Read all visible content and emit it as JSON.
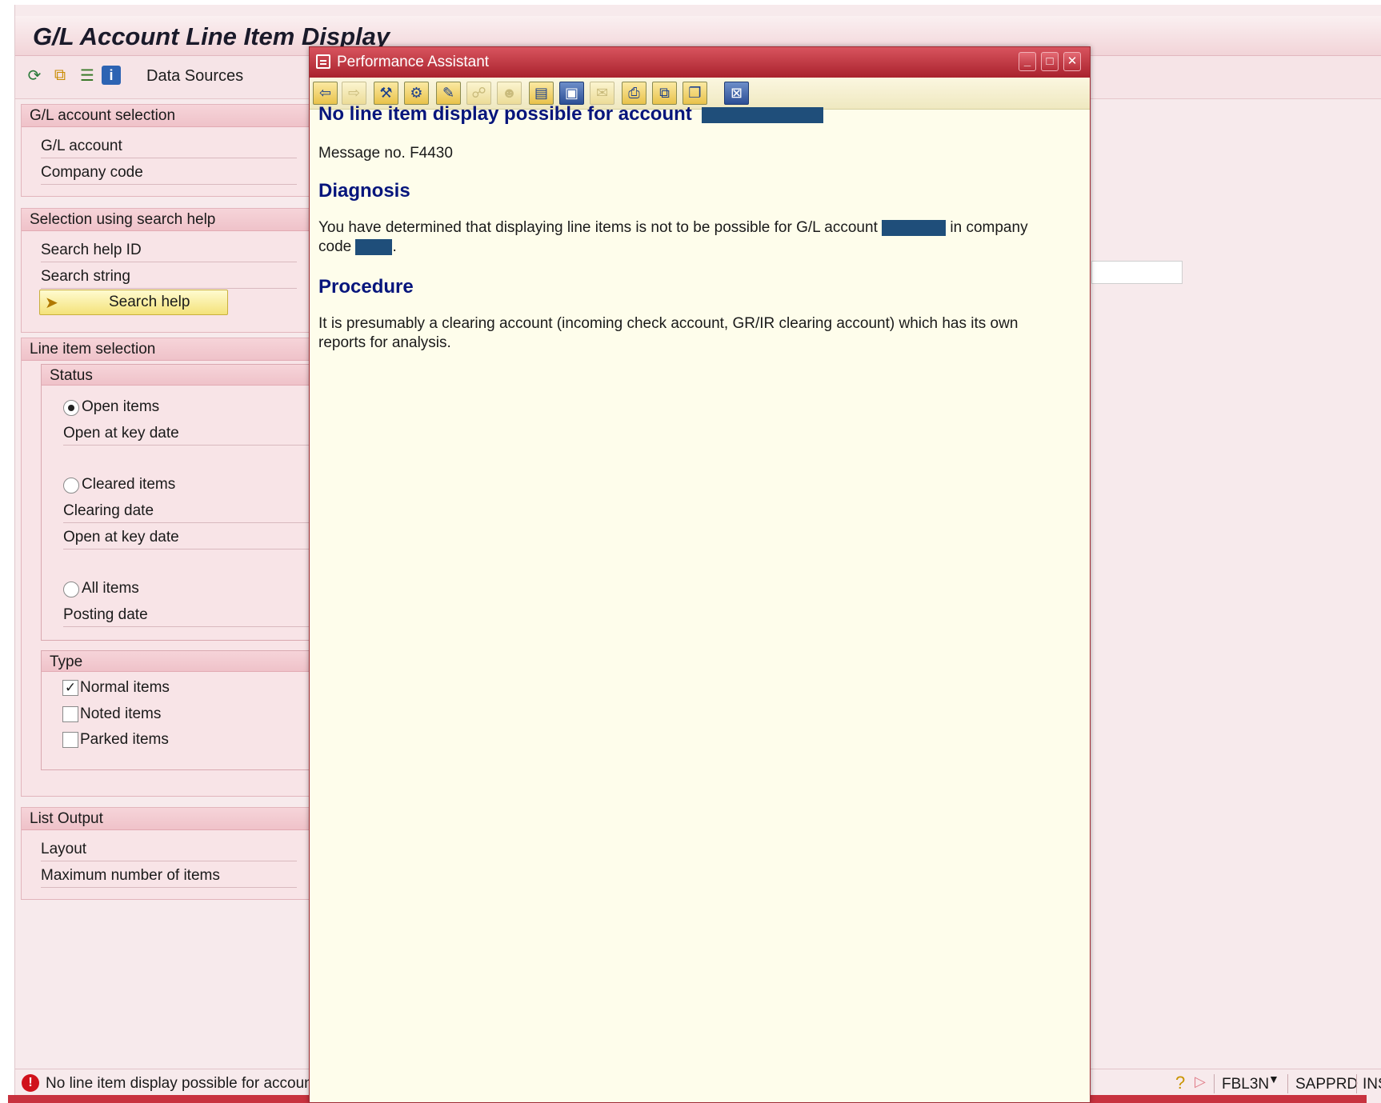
{
  "main": {
    "title": "G/L Account Line Item Display",
    "toolbar": {
      "data_sources_label": "Data Sources",
      "icons": [
        "execute-icon",
        "copy-icon",
        "multicolor-list-icon",
        "info-icon"
      ]
    },
    "groups": {
      "gl_account_selection": {
        "header": "G/L account selection",
        "fields": [
          "G/L account",
          "Company code"
        ]
      },
      "search_help_selection": {
        "header": "Selection using search help",
        "fields": [
          "Search help ID",
          "Search string"
        ],
        "button_label": "Search help"
      },
      "line_item_selection": {
        "header": "Line item selection",
        "status": {
          "header": "Status",
          "open_items": "Open items",
          "open_at_key_date": "Open at key date",
          "cleared_items": "Cleared items",
          "clearing_date": "Clearing date",
          "cleared_open_at_key_date": "Open at key date",
          "all_items": "All items",
          "posting_date": "Posting date",
          "selected": "open_items"
        },
        "type": {
          "header": "Type",
          "normal_items": "Normal items",
          "noted_items": "Noted items",
          "parked_items": "Parked items",
          "normal_checked": true,
          "noted_checked": false,
          "parked_checked": false
        }
      },
      "list_output": {
        "header": "List Output",
        "fields": [
          "Layout",
          "Maximum number of items"
        ]
      }
    }
  },
  "status_bar": {
    "message": "No line item display possible for account",
    "transaction": "FBL3N",
    "system": "SAPPRD",
    "mode": "INS"
  },
  "popup": {
    "title": "Performance Assistant",
    "heading": "No line item display possible for account",
    "message_number": "Message no. F4430",
    "diagnosis_title": "Diagnosis",
    "diagnosis_text_1": "You have determined that displaying line items is not to be possible for G/L account",
    "diagnosis_text_2": "in company",
    "diagnosis_text_3": "code",
    "diagnosis_text_4": ".",
    "procedure_title": "Procedure",
    "procedure_text": "It is presumably a clearing account (incoming check account, GR/IR clearing account) which has its own reports for analysis.",
    "toolbar_icons": [
      "back-icon",
      "forward-icon",
      "technical-info-icon",
      "settings-icon",
      "edit-icon",
      "disabled-link-icon",
      "disabled-user-icon",
      "display-icon",
      "screen-icon",
      "disabled-comment-icon",
      "print-icon",
      "export-icon",
      "copy-icon",
      "close-icon"
    ]
  },
  "colors": {
    "background": "#f7eaec",
    "header_red": "#a9222d",
    "popup_background": "#fefdeb",
    "heading_blue": "#06157c",
    "redaction": "#1f4e7a"
  }
}
